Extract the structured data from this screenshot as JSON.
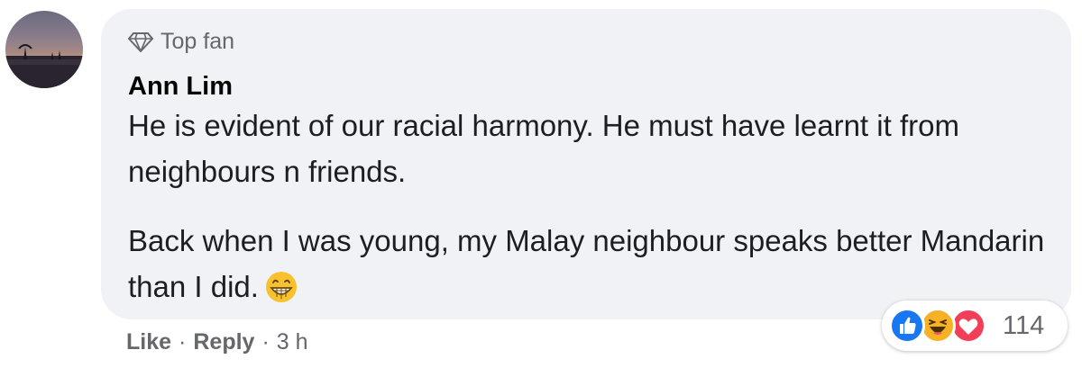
{
  "comment": {
    "badge_label": "Top fan",
    "badge_icon": "diamond-icon",
    "author": "Ann Lim",
    "paragraphs": [
      "He is evident of our racial harmony. He must have learnt it from neighbours n friends.",
      "Back when I was young, my Malay neighbour speaks better Mandarin than I did."
    ],
    "trailing_emoji": "grinning-face-icon"
  },
  "reactions": {
    "types": [
      "like",
      "haha",
      "love"
    ],
    "count": "114",
    "colors": {
      "like": "#1877f2",
      "haha": "#f7b125",
      "love": "#f33e58"
    }
  },
  "actions": {
    "like_label": "Like",
    "reply_label": "Reply",
    "separator": "·",
    "timestamp": "3 h"
  },
  "colors": {
    "bubble": "#f0f2f5",
    "secondary_text": "#65676b"
  }
}
